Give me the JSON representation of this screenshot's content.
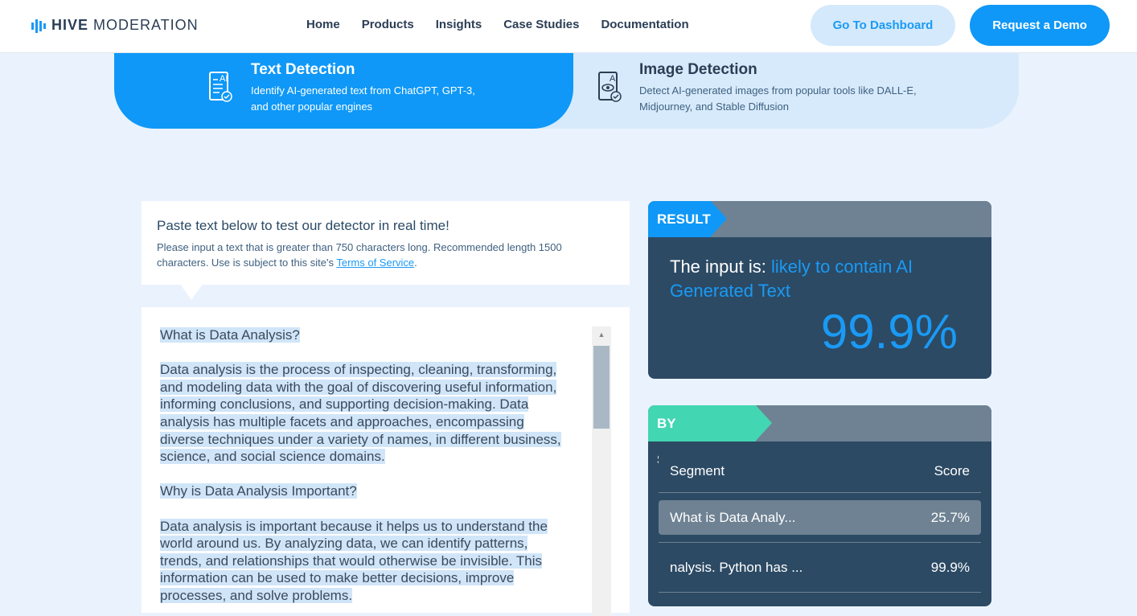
{
  "header": {
    "logo_bold": "HIVE",
    "logo_light": "MODERATION",
    "nav": [
      "Home",
      "Products",
      "Insights",
      "Case Studies",
      "Documentation"
    ],
    "dashboard_label": "Go To Dashboard",
    "demo_label": "Request a Demo"
  },
  "tabs": [
    {
      "title": "Text Detection",
      "desc": "Identify AI-generated text from ChatGPT, GPT-3, and other popular engines",
      "icon": "ai-text-document-icon",
      "active": true
    },
    {
      "title": "Image Detection",
      "desc": "Detect AI-generated images from popular tools like DALL-E, Midjourney, and Stable Diffusion",
      "icon": "ai-image-eye-icon",
      "active": false
    }
  ],
  "input_panel": {
    "heading": "Paste text below to test our detector in real time!",
    "instructions": "Please input a text that is greater than 750 characters long. Recommended length 1500 characters. Use is subject to this site's ",
    "tos_link": "Terms of Service",
    "period": "."
  },
  "editor": {
    "paragraphs": [
      [
        "What is Data Analysis?"
      ],
      [
        "Data analysis is the process of inspecting, cleaning, transforming,",
        "and modeling data with the goal of discovering useful information,",
        "informing conclusions, and supporting decision-making. Data",
        "analysis has multiple facets and approaches, encompassing",
        "diverse techniques under a variety of names, in different business,",
        "science, and social science domains."
      ],
      [
        "Why is Data Analysis Important?"
      ],
      [
        "Data analysis is important because it helps us to understand the",
        "world around us. By analyzing data, we can identify patterns,",
        "trends, and relationships that would otherwise be invisible. This",
        "information can be used to make better decisions, improve",
        "processes, and solve problems."
      ]
    ]
  },
  "result": {
    "badge": "RESULT",
    "prefix": "The input is: ",
    "verdict": "likely to contain AI Generated Text",
    "percent": "99.9%"
  },
  "segments": {
    "badge": "BY SEGMENTS",
    "col_segment": "Segment",
    "col_score": "Score",
    "rows": [
      {
        "segment": "What is Data Analy...",
        "score": "25.7%"
      },
      {
        "segment": "nalysis. Python has ...",
        "score": "99.9%"
      }
    ]
  },
  "colors": {
    "accent": "#0f98f7",
    "teal": "#42d6b3",
    "card": "#2c4a64",
    "card_header": "#6e8293"
  }
}
